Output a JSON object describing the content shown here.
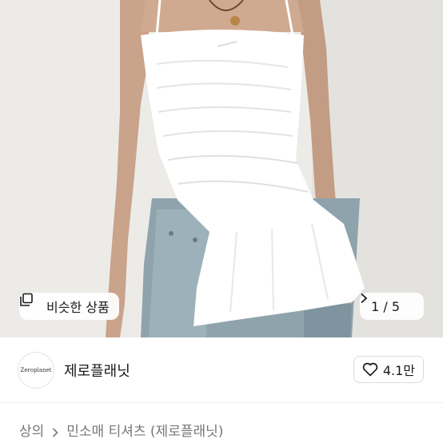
{
  "product_image": {
    "similar_button_label": "비슷한 상품",
    "similar_icon": "similar-items-icon",
    "counter_label": "1 / 5",
    "next_icon": "chevron-right-icon"
  },
  "seller": {
    "avatar_text": "Zeroplanet",
    "name": "제로플래닛",
    "likes_label": "4.1만",
    "like_icon": "heart-outline-icon"
  },
  "breadcrumb": {
    "items": [
      "상의",
      "민소매 티셔츠 (제로플래닛)"
    ],
    "separator_icon": "chevron-right-icon"
  }
}
